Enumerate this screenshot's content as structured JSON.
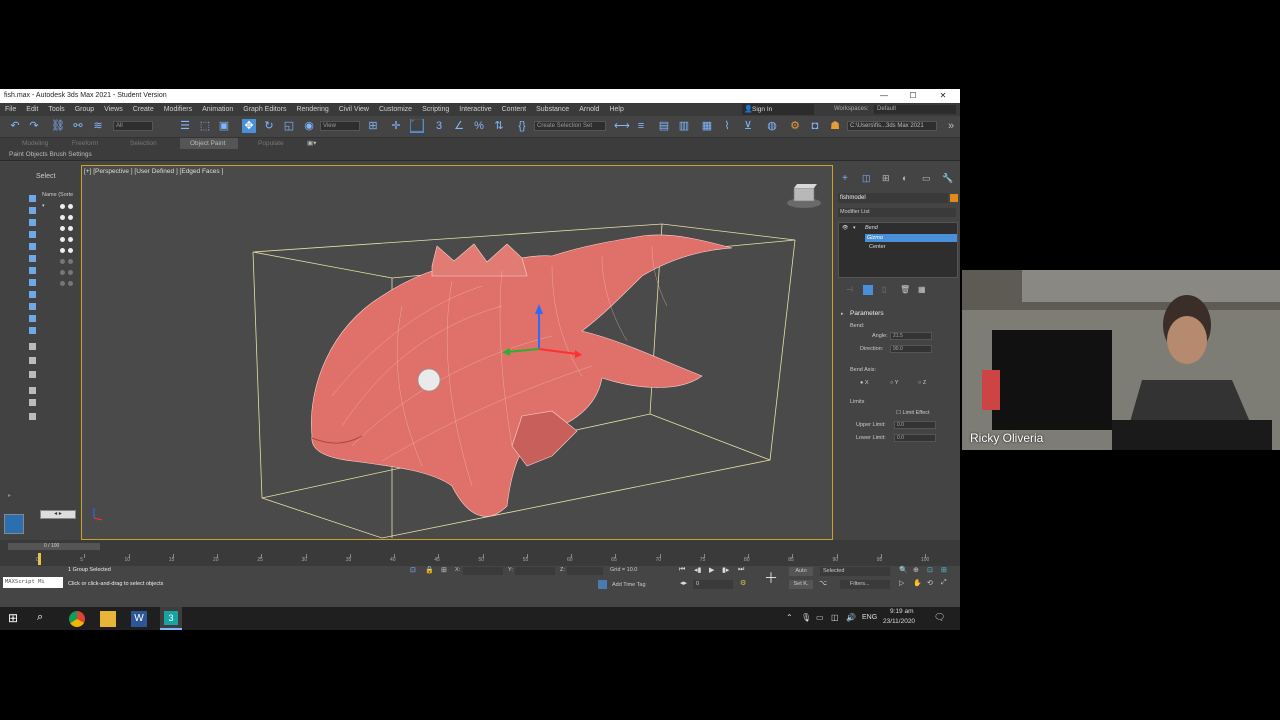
{
  "window": {
    "title": "fish.max - Autodesk 3ds Max 2021 - Student Version",
    "controls": [
      "—",
      "☐",
      "✕"
    ]
  },
  "menu": {
    "items": [
      "File",
      "Edit",
      "Tools",
      "Group",
      "Views",
      "Create",
      "Modifiers",
      "Animation",
      "Graph Editors",
      "Rendering",
      "Civil View",
      "Customize",
      "Scripting",
      "Interactive",
      "Content",
      "Substance",
      "Arnold",
      "Help"
    ],
    "sign_in": "Sign In",
    "workspaces_label": "Workspaces:",
    "workspaces_value": "Default"
  },
  "toolbar": {
    "filter_value": "All",
    "view_value": "View",
    "selection_set_placeholder": "Create Selection Set",
    "path_value": "C:\\Users\\fis...3ds Max 2021"
  },
  "ribbon": {
    "tabs": [
      "Modeling",
      "Freeform",
      "Selection",
      "Object Paint",
      "Populate"
    ],
    "subtabs": "Paint Objects  Brush Settings"
  },
  "explorer": {
    "select_label": "Select",
    "name_header": "Name (Sorte"
  },
  "viewport": {
    "label": "[+] [Perspective ] [User Defined ] [Edged Faces ]"
  },
  "command_panel": {
    "object_name": "fishmodel",
    "modifier_list": "Modifier List",
    "stack": [
      "Bend",
      "Gizmo",
      "Center"
    ],
    "rollout_title": "Parameters",
    "bend_label": "Bend:",
    "angle_label": "Angle:",
    "angle_value": "21.5",
    "direction_label": "Direction:",
    "direction_value": "90.0",
    "bend_axis_label": "Bend Axis:",
    "axes": [
      "X",
      "Y",
      "Z"
    ],
    "limits_label": "Limits",
    "limit_effect": "Limit Effect",
    "upper_limit_label": "Upper Limit:",
    "upper_limit_value": "0.0",
    "lower_limit_label": "Lower Limit:",
    "lower_limit_value": "0.0"
  },
  "timeline": {
    "frame_indicator": "0 / 100",
    "ticks": [
      "0",
      "5",
      "10",
      "15",
      "20",
      "25",
      "30",
      "35",
      "40",
      "45",
      "50",
      "55",
      "60",
      "65",
      "70",
      "75",
      "80",
      "85",
      "90",
      "95",
      "100"
    ]
  },
  "status": {
    "maxscript": "MAXScript Mi",
    "selected": "1 Group Selected",
    "hint": "Click or click-and-drag to select objects",
    "x_label": "X:",
    "y_label": "Y:",
    "z_label": "Z:",
    "grid": "Grid = 10.0",
    "add_time_tag": "Add Time Tag",
    "frame_value": "0",
    "auto": "Auto",
    "selected_dropdown": "Selected",
    "set_k": "Set K.",
    "filters": "Filters..."
  },
  "taskbar": {
    "time": "9:19 am",
    "date": "23/11/2020",
    "lang": "ENG"
  },
  "webcam": {
    "participant_name": "Ricky Oliveria"
  },
  "colors": {
    "accent": "#4a90d9",
    "fish": "#e0706a",
    "selection": "#c9a227"
  }
}
